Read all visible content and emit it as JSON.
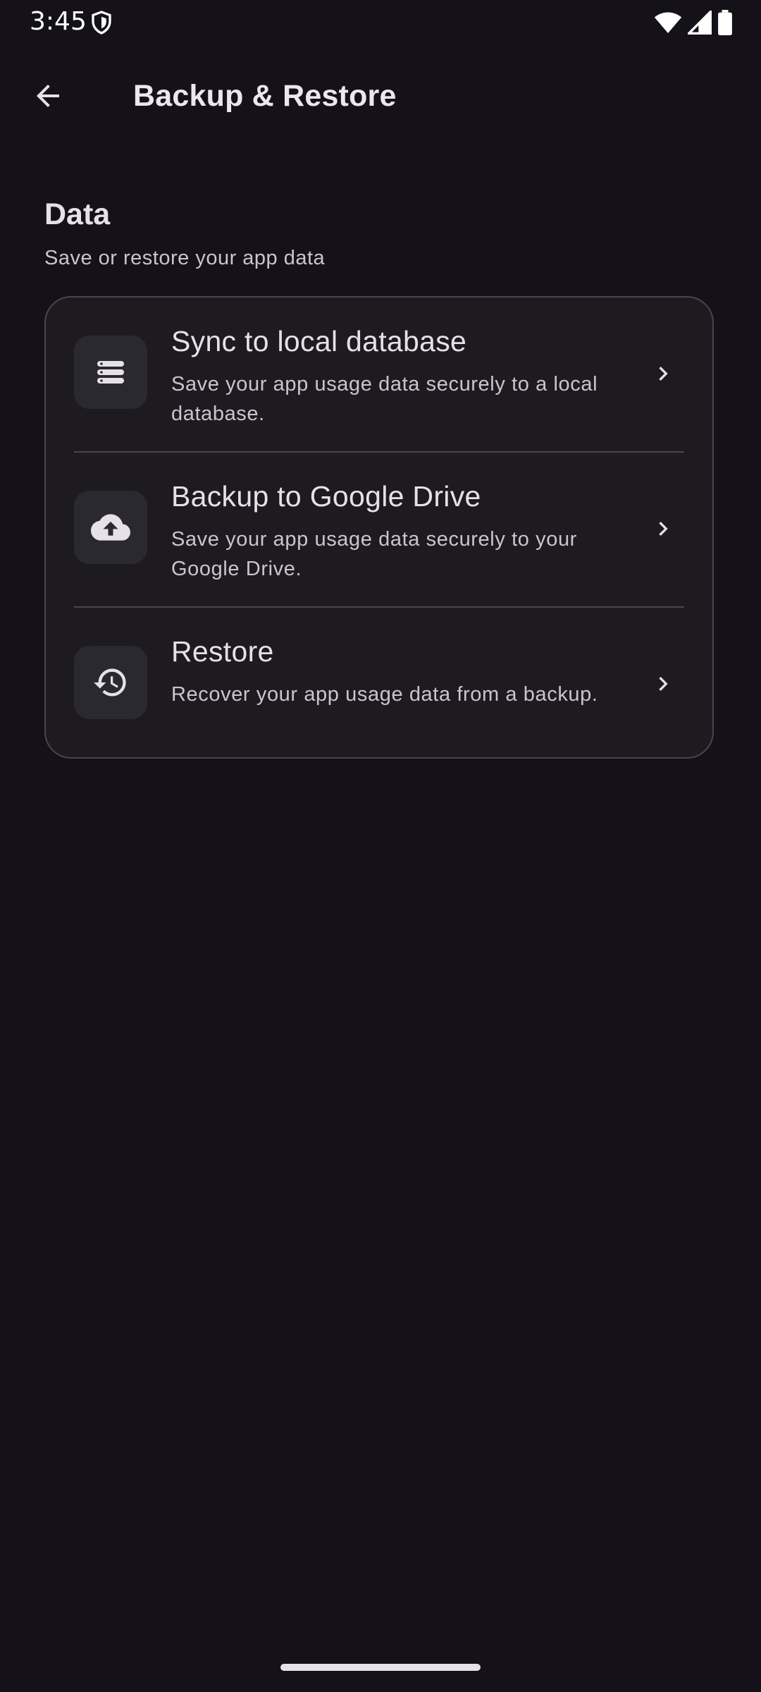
{
  "status_bar": {
    "time": "3:45",
    "icons": [
      "shield-icon",
      "wifi-icon",
      "signal-icon",
      "battery-icon"
    ]
  },
  "app_bar": {
    "title": "Backup & Restore",
    "back_icon": "arrow-back-icon"
  },
  "section": {
    "title": "Data",
    "subtitle": "Save or restore your app data"
  },
  "options": [
    {
      "icon": "database-icon",
      "title": "Sync to local database",
      "description": "Save your app usage data securely to a local database."
    },
    {
      "icon": "cloud-upload-icon",
      "title": "Backup to Google Drive",
      "description": "Save your app usage data securely to your Google Drive."
    },
    {
      "icon": "restore-history-icon",
      "title": "Restore",
      "description": "Recover your app usage data from a backup."
    }
  ],
  "colors": {
    "background": "#141218",
    "card": "#1d1b20",
    "icon_container": "#2b2930",
    "outline": "#48454e",
    "on_surface": "#e6e0e9",
    "on_surface_variant": "#cac4d0"
  }
}
